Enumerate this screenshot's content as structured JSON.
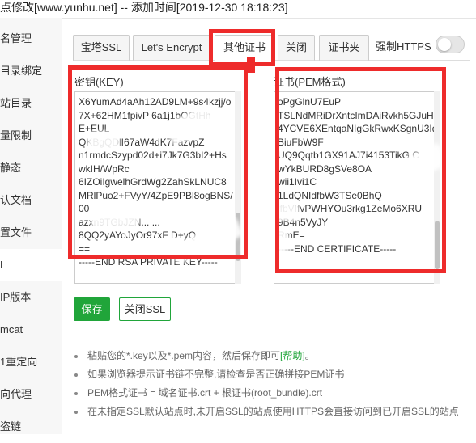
{
  "window_title": "点修改[www.yunhu.net] -- 添加时间[2019-12-30 18:18:23]",
  "sidebar": {
    "items": [
      {
        "label": "名管理"
      },
      {
        "label": "目录绑定"
      },
      {
        "label": "站目录"
      },
      {
        "label": "量限制"
      },
      {
        "label": "静态"
      },
      {
        "label": "认文档"
      },
      {
        "label": "置文件"
      },
      {
        "label": "L"
      },
      {
        "label": "IP版本"
      },
      {
        "label": "mcat"
      },
      {
        "label": "1重定向"
      },
      {
        "label": "向代理"
      },
      {
        "label": "盗链"
      }
    ]
  },
  "tabs": [
    {
      "label": "宝塔SSL"
    },
    {
      "label": "Let's Encrypt"
    },
    {
      "label": "其他证书"
    },
    {
      "label": "关闭"
    },
    {
      "label": "证书夹"
    }
  ],
  "force_https": {
    "label": "强制HTTPS",
    "enabled": false
  },
  "key_panel": {
    "label": "密钥(KEY)",
    "lines": [
      "X6YumAd4aAh12AD9LM+9s4kzjj/o",
      "7X+62HM1fpivP  6a1j1bOGtHh",
      "E+EUL",
      "QKBgQDlI67aW4dK7FazvpZ",
      "n1rmdcSzypd02d+i7Jk7G3bI2+Hs",
      "wkIH/WpRc",
      "6IZOiIgwelhGrdWg2ZahSkLNUC8",
      "MRlPuo2+FVyY/4ZpE9PBl8ogBNS/",
      "                    00",
      "azxn9TGbJZN...  ...",
      "8QQ2yAYoJyOr97xF       D+yQ",
      "==",
      "-----END RSA PRIVATE KEY-----"
    ]
  },
  "cert_panel": {
    "label": "证书(PEM格式)",
    "lines": [
      "oPgGlnU7EuP",
      "TSLNdMRiDrXntcImDAiRvkh5GJuH",
      "4YCVE6XEntqaNIgGkRwxKSgnU3Id",
      "BiuFbW9F",
      "UQ9Qqtb1GX91AJ7i4153TikG  C",
      "wYkBURD8gSVe8OA",
      "wii1Ivi1C",
      "    1LdQNIdfbW3TSe0BhQ",
      "ifbVIfvPWHYOu3rkg1ZeMo6XRU",
      "9B4n5VyJY",
      "RmE=",
      "-----END CERTIFICATE-----"
    ]
  },
  "buttons": {
    "save": "保存",
    "close_ssl": "关闭SSL"
  },
  "tips": [
    {
      "text": "粘贴您的*.key以及*.pem内容，然后保存即可",
      "help": "[帮助]",
      "suffix": "。"
    },
    {
      "text": "如果浏览器提示证书链不完整,请检查是否正确拼接PEM证书"
    },
    {
      "text": "PEM格式证书 = 域名证书.crt + 根证书(root_bundle).crt"
    },
    {
      "text": "在未指定SSL默认站点时,未开启SSL的站点使用HTTPS会直接访问到已开启SSL的站点"
    }
  ],
  "colors": {
    "accent": "#20a53a",
    "highlight": "#ee2b2b"
  }
}
